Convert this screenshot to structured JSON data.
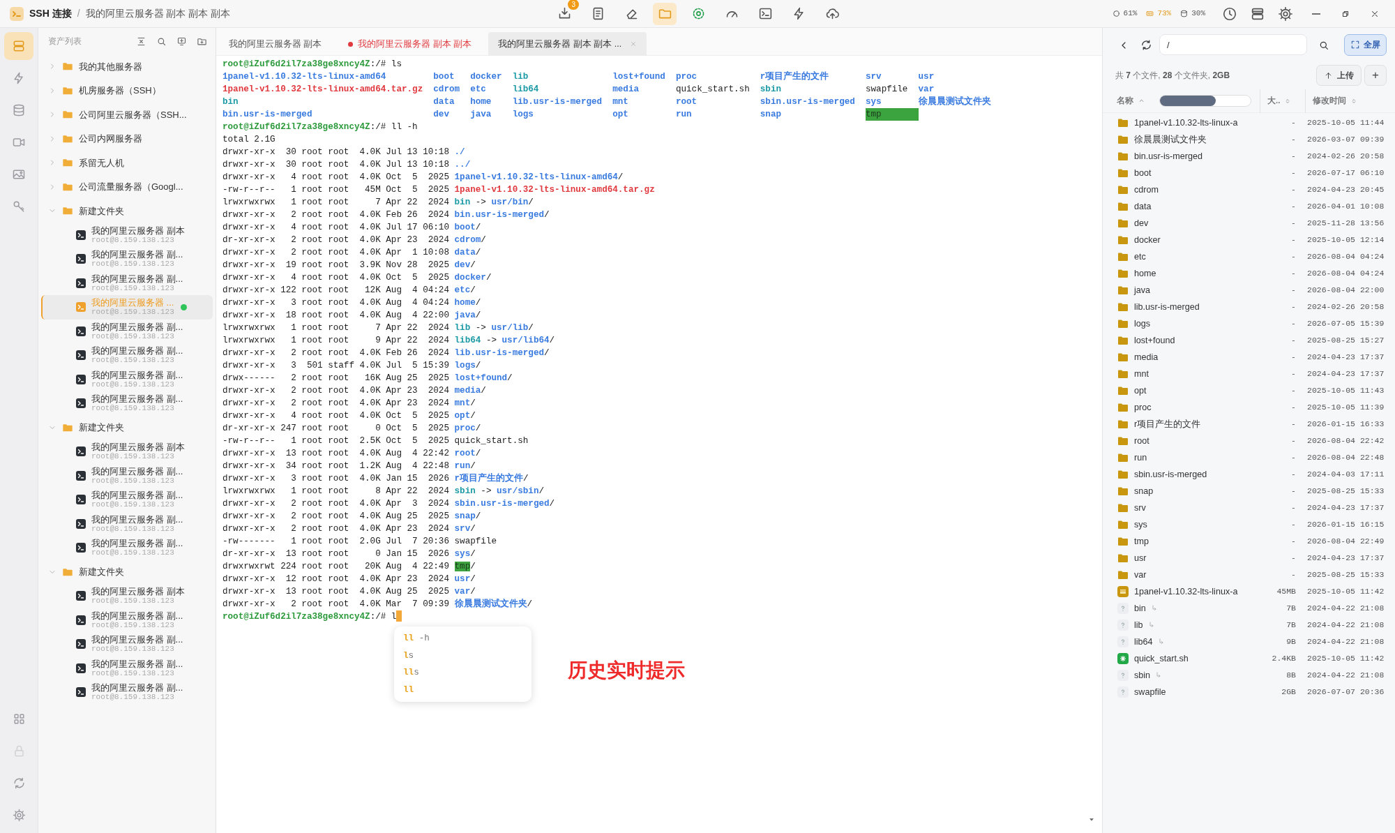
{
  "title_bar": {
    "app": "SSH 连接",
    "separator": "/",
    "session": "我的阿里云服务器 副本 副本 副本"
  },
  "toolbar": [
    {
      "badge": "3",
      "selected": false
    },
    {
      "selected": false
    },
    {
      "selected": false
    },
    {
      "selected": true
    },
    {
      "selected": false
    },
    {
      "selected": false
    },
    {
      "selected": false
    },
    {
      "selected": false
    },
    {
      "selected": false
    }
  ],
  "stats": [
    {
      "value": "61%",
      "alert": false
    },
    {
      "value": "73%",
      "alert": true
    },
    {
      "value": "30%",
      "alert": false
    }
  ],
  "rail": {
    "top": [
      {
        "selected": true
      },
      {
        "selected": false
      },
      {
        "selected": false
      },
      {
        "selected": false
      },
      {
        "selected": false
      },
      {
        "selected": false
      }
    ],
    "bottom": [
      {
        "disabled": false
      },
      {
        "disabled": true
      },
      {
        "disabled": false
      },
      {
        "disabled": false
      }
    ]
  },
  "sidebar": {
    "title": "资产列表",
    "tree": [
      {
        "name": "我的其他服务器",
        "expanded": false
      },
      {
        "name": "机房服务器（SSH）",
        "expanded": false
      },
      {
        "name": "公司阿里云服务器（SSH...",
        "expanded": false
      },
      {
        "name": "公司内网服务器",
        "expanded": false
      },
      {
        "name": "系留无人机",
        "expanded": false
      },
      {
        "name": "公司流量服务器（Googl...",
        "expanded": false
      },
      {
        "name": "新建文件夹",
        "expanded": true,
        "children": [
          {
            "name": "我的阿里云服务器 副本",
            "address": "root@8.159.138.123",
            "selected": false,
            "online": false
          },
          {
            "name": "我的阿里云服务器 副...",
            "address": "root@8.159.138.123",
            "selected": false,
            "online": false
          },
          {
            "name": "我的阿里云服务器 副...",
            "address": "root@8.159.138.123",
            "selected": false,
            "online": false
          },
          {
            "name": "我的阿里云服务器 ...",
            "address": "root@8.159.138.123",
            "selected": true,
            "online": true
          },
          {
            "name": "我的阿里云服务器 副...",
            "address": "root@8.159.138.123",
            "selected": false,
            "online": false
          },
          {
            "name": "我的阿里云服务器 副...",
            "address": "root@8.159.138.123",
            "selected": false,
            "online": false
          },
          {
            "name": "我的阿里云服务器 副...",
            "address": "root@8.159.138.123",
            "selected": false,
            "online": false
          },
          {
            "name": "我的阿里云服务器 副...",
            "address": "root@8.159.138.123",
            "selected": false,
            "online": false
          }
        ]
      },
      {
        "name": "新建文件夹",
        "expanded": true,
        "children": [
          {
            "name": "我的阿里云服务器 副本",
            "address": "root@8.159.138.123",
            "selected": false,
            "online": false
          },
          {
            "name": "我的阿里云服务器 副...",
            "address": "root@8.159.138.123",
            "selected": false,
            "online": false
          },
          {
            "name": "我的阿里云服务器 副...",
            "address": "root@8.159.138.123",
            "selected": false,
            "online": false
          },
          {
            "name": "我的阿里云服务器 副...",
            "address": "root@8.159.138.123",
            "selected": false,
            "online": false
          },
          {
            "name": "我的阿里云服务器 副...",
            "address": "root@8.159.138.123",
            "selected": false,
            "online": false
          }
        ]
      },
      {
        "name": "新建文件夹",
        "expanded": true,
        "children": [
          {
            "name": "我的阿里云服务器 副本",
            "address": "root@8.159.138.123",
            "selected": false,
            "online": false
          },
          {
            "name": "我的阿里云服务器 副...",
            "address": "root@8.159.138.123",
            "selected": false,
            "online": false
          },
          {
            "name": "我的阿里云服务器 副...",
            "address": "root@8.159.138.123",
            "selected": false,
            "online": false
          },
          {
            "name": "我的阿里云服务器 副...",
            "address": "root@8.159.138.123",
            "selected": false,
            "online": false
          },
          {
            "name": "我的阿里云服务器 副...",
            "address": "root@8.159.138.123",
            "selected": false,
            "online": false
          }
        ]
      }
    ]
  },
  "tabs": [
    {
      "label": "我的阿里云服务器 副本",
      "selected": false,
      "modified": false,
      "closable": false
    },
    {
      "label": "我的阿里云服务器 副本 副本",
      "selected": false,
      "modified": true,
      "closable": false
    },
    {
      "label": "我的阿里云服务器 副本 副本 ...",
      "selected": true,
      "modified": false,
      "closable": true
    }
  ],
  "terminal": {
    "cursor": true,
    "lines": [
      {
        "kind": "text",
        "segments": [
          {
            "text": "root@iZuf6d2il7za38ge8xncy4Z",
            "kind": "prompt"
          },
          {
            "text": ":/# ls",
            "kind": "plain"
          }
        ]
      },
      {
        "kind": "ls",
        "cells": [
          {
            "text": "1panel-v1.10.32-lts-linux-amd64",
            "kind": "dir"
          },
          {
            "text": "boot",
            "kind": "dir"
          },
          {
            "text": "docker",
            "kind": "dir"
          },
          {
            "text": "lib",
            "kind": "link"
          },
          {
            "text": "lost+found",
            "kind": "dir"
          },
          {
            "text": "proc",
            "kind": "dir"
          },
          {
            "text": "r项目产生的文件",
            "kind": "dir"
          },
          {
            "text": "srv",
            "kind": "dir"
          },
          {
            "text": "usr",
            "kind": "dir"
          }
        ]
      },
      {
        "kind": "ls",
        "cells": [
          {
            "text": "1panel-v1.10.32-lts-linux-amd64.tar.gz",
            "kind": "archive"
          },
          {
            "text": "cdrom",
            "kind": "dir"
          },
          {
            "text": "etc",
            "kind": "dir"
          },
          {
            "text": "lib64",
            "kind": "link"
          },
          {
            "text": "media",
            "kind": "dir"
          },
          {
            "text": "quick_start.sh",
            "kind": "plain"
          },
          {
            "text": "sbin",
            "kind": "link"
          },
          {
            "text": "swapfile",
            "kind": "plain"
          },
          {
            "text": "var",
            "kind": "dir"
          }
        ]
      },
      {
        "kind": "ls",
        "cells": [
          {
            "text": "bin",
            "kind": "link"
          },
          {
            "text": "data",
            "kind": "dir"
          },
          {
            "text": "home",
            "kind": "dir"
          },
          {
            "text": "lib.usr-is-merged",
            "kind": "dir"
          },
          {
            "text": "mnt",
            "kind": "dir"
          },
          {
            "text": "root",
            "kind": "dir"
          },
          {
            "text": "sbin.usr-is-merged",
            "kind": "dir"
          },
          {
            "text": "sys",
            "kind": "dir"
          },
          {
            "text": "徐晨晨测试文件夹",
            "kind": "dir"
          }
        ]
      },
      {
        "kind": "ls",
        "cells": [
          {
            "text": "bin.usr-is-merged",
            "kind": "dir"
          },
          {
            "text": "dev",
            "kind": "dir"
          },
          {
            "text": "java",
            "kind": "dir"
          },
          {
            "text": "logs",
            "kind": "dir"
          },
          {
            "text": "opt",
            "kind": "dir"
          },
          {
            "text": "run",
            "kind": "dir"
          },
          {
            "text": "snap",
            "kind": "dir"
          },
          {
            "text": "tmp",
            "kind": "highlight"
          }
        ]
      },
      {
        "kind": "text",
        "segments": [
          {
            "text": "root@iZuf6d2il7za38ge8xncy4Z",
            "kind": "prompt"
          },
          {
            "text": ":/# ll -h",
            "kind": "plain"
          }
        ]
      },
      {
        "kind": "text",
        "segments": [
          {
            "text": "total 2.1G",
            "kind": "plain"
          }
        ]
      },
      {
        "kind": "text",
        "segments": [
          {
            "text": "drwxr-xr-x  30 root root  4.0K Jul 13 10:18 ",
            "kind": "plain"
          },
          {
            "text": "./",
            "kind": "dir"
          }
        ]
      },
      {
        "kind": "text",
        "segments": [
          {
            "text": "drwxr-xr-x  30 root root  4.0K Jul 13 10:18 ",
            "kind": "plain"
          },
          {
            "text": "../",
            "kind": "dir"
          }
        ]
      },
      {
        "kind": "text",
        "segments": [
          {
            "text": "drwxr-xr-x   4 root root  4.0K Oct  5  2025 ",
            "kind": "plain"
          },
          {
            "text": "1panel-v1.10.32-lts-linux-amd64",
            "kind": "dir"
          },
          {
            "text": "/",
            "kind": "plain"
          }
        ]
      },
      {
        "kind": "text",
        "segments": [
          {
            "text": "-rw-r--r--   1 root root   45M Oct  5  2025 ",
            "kind": "plain"
          },
          {
            "text": "1panel-v1.10.32-lts-linux-amd64.tar.gz",
            "kind": "archive"
          }
        ]
      },
      {
        "kind": "text",
        "segments": [
          {
            "text": "lrwxrwxrwx   1 root root     7 Apr 22  2024 ",
            "kind": "plain"
          },
          {
            "text": "bin",
            "kind": "link"
          },
          {
            "text": " -> ",
            "kind": "plain"
          },
          {
            "text": "usr/bin",
            "kind": "dir"
          },
          {
            "text": "/",
            "kind": "plain"
          }
        ]
      },
      {
        "kind": "text",
        "segments": [
          {
            "text": "drwxr-xr-x   2 root root  4.0K Feb 26  2024 ",
            "kind": "plain"
          },
          {
            "text": "bin.usr-is-merged",
            "kind": "dir"
          },
          {
            "text": "/",
            "kind": "plain"
          }
        ]
      },
      {
        "kind": "text",
        "segments": [
          {
            "text": "drwxr-xr-x   4 root root  4.0K Jul 17 06:10 ",
            "kind": "plain"
          },
          {
            "text": "boot",
            "kind": "dir"
          },
          {
            "text": "/",
            "kind": "plain"
          }
        ]
      },
      {
        "kind": "text",
        "segments": [
          {
            "text": "dr-xr-xr-x   2 root root  4.0K Apr 23  2024 ",
            "kind": "plain"
          },
          {
            "text": "cdrom",
            "kind": "dir"
          },
          {
            "text": "/",
            "kind": "plain"
          }
        ]
      },
      {
        "kind": "text",
        "segments": [
          {
            "text": "drwxr-xr-x   2 root root  4.0K Apr  1 10:08 ",
            "kind": "plain"
          },
          {
            "text": "data",
            "kind": "dir"
          },
          {
            "text": "/",
            "kind": "plain"
          }
        ]
      },
      {
        "kind": "text",
        "segments": [
          {
            "text": "drwxr-xr-x  19 root root  3.9K Nov 28  2025 ",
            "kind": "plain"
          },
          {
            "text": "dev",
            "kind": "dir"
          },
          {
            "text": "/",
            "kind": "plain"
          }
        ]
      },
      {
        "kind": "text",
        "segments": [
          {
            "text": "drwxr-xr-x   4 root root  4.0K Oct  5  2025 ",
            "kind": "plain"
          },
          {
            "text": "docker",
            "kind": "dir"
          },
          {
            "text": "/",
            "kind": "plain"
          }
        ]
      },
      {
        "kind": "text",
        "segments": [
          {
            "text": "drwxr-xr-x 122 root root   12K Aug  4 04:24 ",
            "kind": "plain"
          },
          {
            "text": "etc",
            "kind": "dir"
          },
          {
            "text": "/",
            "kind": "plain"
          }
        ]
      },
      {
        "kind": "text",
        "segments": [
          {
            "text": "drwxr-xr-x   3 root root  4.0K Aug  4 04:24 ",
            "kind": "plain"
          },
          {
            "text": "home",
            "kind": "dir"
          },
          {
            "text": "/",
            "kind": "plain"
          }
        ]
      },
      {
        "kind": "text",
        "segments": [
          {
            "text": "drwxr-xr-x  18 root root  4.0K Aug  4 22:00 ",
            "kind": "plain"
          },
          {
            "text": "java",
            "kind": "dir"
          },
          {
            "text": "/",
            "kind": "plain"
          }
        ]
      },
      {
        "kind": "text",
        "segments": [
          {
            "text": "lrwxrwxrwx   1 root root     7 Apr 22  2024 ",
            "kind": "plain"
          },
          {
            "text": "lib",
            "kind": "link"
          },
          {
            "text": " -> ",
            "kind": "plain"
          },
          {
            "text": "usr/lib",
            "kind": "dir"
          },
          {
            "text": "/",
            "kind": "plain"
          }
        ]
      },
      {
        "kind": "text",
        "segments": [
          {
            "text": "lrwxrwxrwx   1 root root     9 Apr 22  2024 ",
            "kind": "plain"
          },
          {
            "text": "lib64",
            "kind": "link"
          },
          {
            "text": " -> ",
            "kind": "plain"
          },
          {
            "text": "usr/lib64",
            "kind": "dir"
          },
          {
            "text": "/",
            "kind": "plain"
          }
        ]
      },
      {
        "kind": "text",
        "segments": [
          {
            "text": "drwxr-xr-x   2 root root  4.0K Feb 26  2024 ",
            "kind": "plain"
          },
          {
            "text": "lib.usr-is-merged",
            "kind": "dir"
          },
          {
            "text": "/",
            "kind": "plain"
          }
        ]
      },
      {
        "kind": "text",
        "segments": [
          {
            "text": "drwxr-xr-x   3  501 staff 4.0K Jul  5 15:39 ",
            "kind": "plain"
          },
          {
            "text": "logs",
            "kind": "dir"
          },
          {
            "text": "/",
            "kind": "plain"
          }
        ]
      },
      {
        "kind": "text",
        "segments": [
          {
            "text": "drwx------   2 root root   16K Aug 25  2025 ",
            "kind": "plain"
          },
          {
            "text": "lost+found",
            "kind": "dir"
          },
          {
            "text": "/",
            "kind": "plain"
          }
        ]
      },
      {
        "kind": "text",
        "segments": [
          {
            "text": "drwxr-xr-x   2 root root  4.0K Apr 23  2024 ",
            "kind": "plain"
          },
          {
            "text": "media",
            "kind": "dir"
          },
          {
            "text": "/",
            "kind": "plain"
          }
        ]
      },
      {
        "kind": "text",
        "segments": [
          {
            "text": "drwxr-xr-x   2 root root  4.0K Apr 23  2024 ",
            "kind": "plain"
          },
          {
            "text": "mnt",
            "kind": "dir"
          },
          {
            "text": "/",
            "kind": "plain"
          }
        ]
      },
      {
        "kind": "text",
        "segments": [
          {
            "text": "drwxr-xr-x   4 root root  4.0K Oct  5  2025 ",
            "kind": "plain"
          },
          {
            "text": "opt",
            "kind": "dir"
          },
          {
            "text": "/",
            "kind": "plain"
          }
        ]
      },
      {
        "kind": "text",
        "segments": [
          {
            "text": "dr-xr-xr-x 247 root root     0 Oct  5  2025 ",
            "kind": "plain"
          },
          {
            "text": "proc",
            "kind": "dir"
          },
          {
            "text": "/",
            "kind": "plain"
          }
        ]
      },
      {
        "kind": "text",
        "segments": [
          {
            "text": "-rw-r--r--   1 root root  2.5K Oct  5  2025 quick_start.sh",
            "kind": "plain"
          }
        ]
      },
      {
        "kind": "text",
        "segments": [
          {
            "text": "drwxr-xr-x  13 root root  4.0K Aug  4 22:42 ",
            "kind": "plain"
          },
          {
            "text": "root",
            "kind": "dir"
          },
          {
            "text": "/",
            "kind": "plain"
          }
        ]
      },
      {
        "kind": "text",
        "segments": [
          {
            "text": "drwxr-xr-x  34 root root  1.2K Aug  4 22:48 ",
            "kind": "plain"
          },
          {
            "text": "run",
            "kind": "dir"
          },
          {
            "text": "/",
            "kind": "plain"
          }
        ]
      },
      {
        "kind": "text",
        "segments": [
          {
            "text": "drwxr-xr-x   3 root root  4.0K Jan 15  2026 ",
            "kind": "plain"
          },
          {
            "text": "r项目产生的文件",
            "kind": "dir"
          },
          {
            "text": "/",
            "kind": "plain"
          }
        ]
      },
      {
        "kind": "text",
        "segments": [
          {
            "text": "lrwxrwxrwx   1 root root     8 Apr 22  2024 ",
            "kind": "plain"
          },
          {
            "text": "sbin",
            "kind": "link"
          },
          {
            "text": " -> ",
            "kind": "plain"
          },
          {
            "text": "usr/sbin",
            "kind": "dir"
          },
          {
            "text": "/",
            "kind": "plain"
          }
        ]
      },
      {
        "kind": "text",
        "segments": [
          {
            "text": "drwxr-xr-x   2 root root  4.0K Apr  3  2024 ",
            "kind": "plain"
          },
          {
            "text": "sbin.usr-is-merged",
            "kind": "dir"
          },
          {
            "text": "/",
            "kind": "plain"
          }
        ]
      },
      {
        "kind": "text",
        "segments": [
          {
            "text": "drwxr-xr-x   2 root root  4.0K Aug 25  2025 ",
            "kind": "plain"
          },
          {
            "text": "snap",
            "kind": "dir"
          },
          {
            "text": "/",
            "kind": "plain"
          }
        ]
      },
      {
        "kind": "text",
        "segments": [
          {
            "text": "drwxr-xr-x   2 root root  4.0K Apr 23  2024 ",
            "kind": "plain"
          },
          {
            "text": "srv",
            "kind": "dir"
          },
          {
            "text": "/",
            "kind": "plain"
          }
        ]
      },
      {
        "kind": "text",
        "segments": [
          {
            "text": "-rw-------   1 root root  2.0G Jul  7 20:36 swapfile",
            "kind": "plain"
          }
        ]
      },
      {
        "kind": "text",
        "segments": [
          {
            "text": "dr-xr-xr-x  13 root root     0 Jan 15  2026 ",
            "kind": "plain"
          },
          {
            "text": "sys",
            "kind": "dir"
          },
          {
            "text": "/",
            "kind": "plain"
          }
        ]
      },
      {
        "kind": "text",
        "segments": [
          {
            "text": "drwxrwxrwt 224 root root   20K Aug  4 22:49 ",
            "kind": "plain"
          },
          {
            "text": "tmp",
            "kind": "highlight"
          },
          {
            "text": "/",
            "kind": "plain"
          }
        ]
      },
      {
        "kind": "text",
        "segments": [
          {
            "text": "drwxr-xr-x  12 root root  4.0K Apr 23  2024 ",
            "kind": "plain"
          },
          {
            "text": "usr",
            "kind": "dir"
          },
          {
            "text": "/",
            "kind": "plain"
          }
        ]
      },
      {
        "kind": "text",
        "segments": [
          {
            "text": "drwxr-xr-x  13 root root  4.0K Aug 25  2025 ",
            "kind": "plain"
          },
          {
            "text": "var",
            "kind": "dir"
          },
          {
            "text": "/",
            "kind": "plain"
          }
        ]
      },
      {
        "kind": "text",
        "segments": [
          {
            "text": "drwxr-xr-x   2 root root  4.0K Mar  7 09:39 ",
            "kind": "plain"
          },
          {
            "text": "徐晨晨测试文件夹",
            "kind": "dir"
          },
          {
            "text": "/",
            "kind": "plain"
          }
        ]
      },
      {
        "kind": "text",
        "segments": [
          {
            "text": "root@iZuf6d2il7za38ge8xncy4Z",
            "kind": "prompt"
          },
          {
            "text": ":/# l",
            "kind": "plain"
          }
        ]
      }
    ],
    "suggestions": [
      "**ll** -h",
      "**l**s",
      "**ll**s",
      "**ll**"
    ],
    "annotation": "历史实时提示"
  },
  "files": {
    "path": "/",
    "fullscreen": "全屏",
    "summary": "共 **7** 个文件, **28** 个文件夹, **2GB**",
    "upload": "上传",
    "add": "+",
    "columns": [
      {
        "label": "名称",
        "sorted": true
      },
      {
        "label": "大..",
        "sorted": false
      },
      {
        "label": "修改时间",
        "sorted": false
      }
    ],
    "rows": [
      {
        "kind": "folder",
        "name": "1panel-v1.10.32-lts-linux-a",
        "link": false,
        "size": "-",
        "modified": "2025-10-05 11:44"
      },
      {
        "kind": "folder",
        "name": "徐晨晨测试文件夹",
        "link": false,
        "size": "-",
        "modified": "2026-03-07 09:39"
      },
      {
        "kind": "folder",
        "name": "bin.usr-is-merged",
        "link": false,
        "size": "-",
        "modified": "2024-02-26 20:58"
      },
      {
        "kind": "folder",
        "name": "boot",
        "link": false,
        "size": "-",
        "modified": "2026-07-17 06:10"
      },
      {
        "kind": "folder",
        "name": "cdrom",
        "link": false,
        "size": "-",
        "modified": "2024-04-23 20:45"
      },
      {
        "kind": "folder",
        "name": "data",
        "link": false,
        "size": "-",
        "modified": "2026-04-01 10:08"
      },
      {
        "kind": "folder",
        "name": "dev",
        "link": false,
        "size": "-",
        "modified": "2025-11-28 13:56"
      },
      {
        "kind": "folder",
        "name": "docker",
        "link": false,
        "size": "-",
        "modified": "2025-10-05 12:14"
      },
      {
        "kind": "folder",
        "name": "etc",
        "link": false,
        "size": "-",
        "modified": "2026-08-04 04:24"
      },
      {
        "kind": "folder",
        "name": "home",
        "link": false,
        "size": "-",
        "modified": "2026-08-04 04:24"
      },
      {
        "kind": "folder",
        "name": "java",
        "link": false,
        "size": "-",
        "modified": "2026-08-04 22:00"
      },
      {
        "kind": "folder",
        "name": "lib.usr-is-merged",
        "link": false,
        "size": "-",
        "modified": "2024-02-26 20:58"
      },
      {
        "kind": "folder",
        "name": "logs",
        "link": false,
        "size": "-",
        "modified": "2026-07-05 15:39"
      },
      {
        "kind": "folder",
        "name": "lost+found",
        "link": false,
        "size": "-",
        "modified": "2025-08-25 15:27"
      },
      {
        "kind": "folder",
        "name": "media",
        "link": false,
        "size": "-",
        "modified": "2024-04-23 17:37"
      },
      {
        "kind": "folder",
        "name": "mnt",
        "link": false,
        "size": "-",
        "modified": "2024-04-23 17:37"
      },
      {
        "kind": "folder",
        "name": "opt",
        "link": false,
        "size": "-",
        "modified": "2025-10-05 11:43"
      },
      {
        "kind": "folder",
        "name": "proc",
        "link": false,
        "size": "-",
        "modified": "2025-10-05 11:39"
      },
      {
        "kind": "folder",
        "name": "r项目产生的文件",
        "link": false,
        "size": "-",
        "modified": "2026-01-15 16:33"
      },
      {
        "kind": "folder",
        "name": "root",
        "link": false,
        "size": "-",
        "modified": "2026-08-04 22:42"
      },
      {
        "kind": "folder",
        "name": "run",
        "link": false,
        "size": "-",
        "modified": "2026-08-04 22:48"
      },
      {
        "kind": "folder",
        "name": "sbin.usr-is-merged",
        "link": false,
        "size": "-",
        "modified": "2024-04-03 17:11"
      },
      {
        "kind": "folder",
        "name": "snap",
        "link": false,
        "size": "-",
        "modified": "2025-08-25 15:33"
      },
      {
        "kind": "folder",
        "name": "srv",
        "link": false,
        "size": "-",
        "modified": "2024-04-23 17:37"
      },
      {
        "kind": "folder",
        "name": "sys",
        "link": false,
        "size": "-",
        "modified": "2026-01-15 16:15"
      },
      {
        "kind": "folder",
        "name": "tmp",
        "link": false,
        "size": "-",
        "modified": "2026-08-04 22:49"
      },
      {
        "kind": "folder",
        "name": "usr",
        "link": false,
        "size": "-",
        "modified": "2024-04-23 17:37"
      },
      {
        "kind": "folder",
        "name": "var",
        "link": false,
        "size": "-",
        "modified": "2025-08-25 15:33"
      },
      {
        "kind": "archive",
        "name": "1panel-v1.10.32-lts-linux-a",
        "link": false,
        "size": "45MB",
        "modified": "2025-10-05 11:42"
      },
      {
        "kind": "unknown",
        "name": "bin",
        "link": true,
        "size": "7B",
        "modified": "2024-04-22 21:08"
      },
      {
        "kind": "unknown",
        "name": "lib",
        "link": true,
        "size": "7B",
        "modified": "2024-04-22 21:08"
      },
      {
        "kind": "unknown",
        "name": "lib64",
        "link": true,
        "size": "9B",
        "modified": "2024-04-22 21:08"
      },
      {
        "kind": "script",
        "name": "quick_start.sh",
        "link": false,
        "size": "2.4KB",
        "modified": "2025-10-05 11:42"
      },
      {
        "kind": "unknown",
        "name": "sbin",
        "link": true,
        "size": "8B",
        "modified": "2024-04-22 21:08"
      },
      {
        "kind": "unknown",
        "name": "swapfile",
        "link": false,
        "size": "2GB",
        "modified": "2026-07-07 20:36"
      }
    ]
  }
}
